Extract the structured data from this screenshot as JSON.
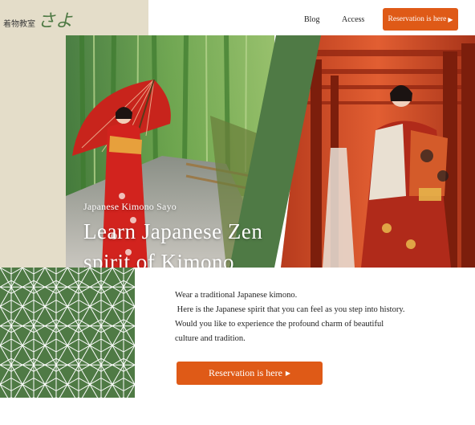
{
  "brand": {
    "small": "着物教室",
    "script": "さよ",
    "accent": "#4f7a45"
  },
  "nav": {
    "items": [
      {
        "label": "Blog"
      },
      {
        "label": "Access"
      }
    ],
    "cta_label": "Reservation is here",
    "cta_icon": "play-triangle-icon",
    "cta_color": "#df5a17"
  },
  "hero": {
    "subtitle": "Japanese Kimono Sayo",
    "title_line1": "Learn Japanese Zen",
    "title_line2": "spirit of Kimono",
    "left_photo": "woman-in-red-kimono-with-umbrella-in-bamboo-grove",
    "right_photo": "woman-in-kimono-among-red-torii-gates",
    "divider_color": "#4f7a45"
  },
  "intro": {
    "lines": [
      "Wear a traditional Japanese kimono.",
      " Here is the Japanese spirit that you can feel as you step into history.",
      "Would you like to experience the profound charm of beautiful",
      "culture and tradition."
    ]
  },
  "main_cta": {
    "label": "Reservation is here",
    "icon": "play-triangle-icon"
  },
  "colors": {
    "beige": "#e4ddc9",
    "green": "#4f7a45",
    "orange": "#df5a17"
  }
}
